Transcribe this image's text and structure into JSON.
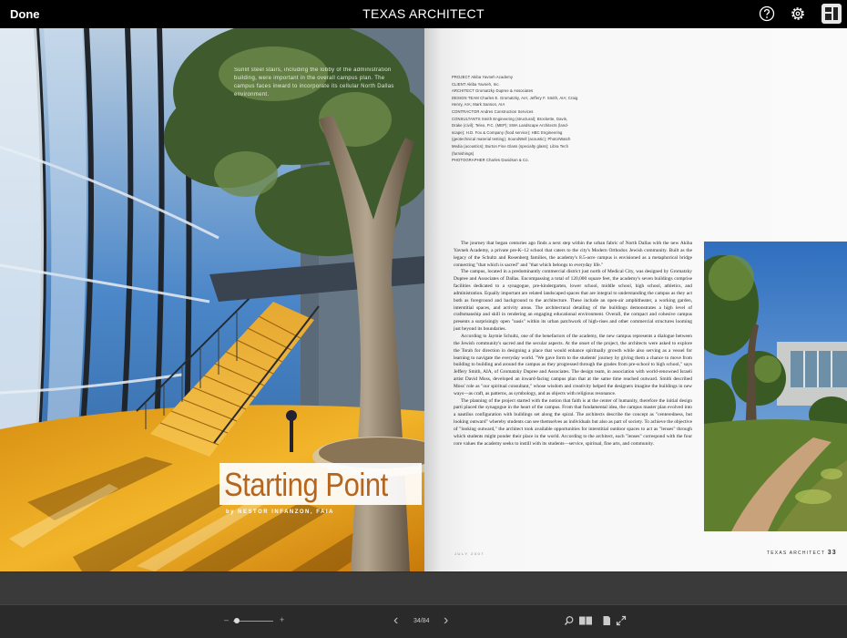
{
  "topbar": {
    "done_label": "Done",
    "title": "TEXAS ARCHITECT",
    "icons": [
      "help-icon",
      "gear-icon",
      "thumbnails-icon"
    ]
  },
  "left_page": {
    "caption": "Sunlit steel stairs, including the lobby of the administration building, were important in the overall campus plan. The campus faces inward to incorporate its cellular North Dallas environment.",
    "feature_title": "Starting Point",
    "byline": "by NESTOR INFANZON, FAIA"
  },
  "right_page": {
    "credits": [
      "PROJECT Akiba Yavneh Academy",
      "CLIENT Akiba Yavneh, Inc.",
      "ARCHITECT Gromatzky Dupree & Associates",
      "DESIGN TEAM Charles E. Gromatzky, AIA; Jeffery F. Smith, AIA; Craig",
      "Henry, AIA; Mark Sanson, AIA",
      "CONTRACTOR Andres Construction Services",
      "CONSULTANTS Smith Engineering (structural); Brockette, Davis,",
      "Drake (civil); Teleo, P.C. (MEP); SWA Landscape Architects (land-",
      "scape); H.D. Fox & Company (food service); HBC Engineering",
      "(geotechnical material testing); SoundWell (acoustic); Photo/Watch",
      "Media (acoustics); Burton Fine Glass (specialty glass); Libra Tech",
      "(furnishings)",
      "PHOTOGRAPHER Charles Davidson & Co."
    ],
    "body_paragraphs": [
      "The journey that began centuries ago finds a next step within the urban fabric of North Dallas with the new Akiba Yavneh Academy, a private pre-K–12 school that caters to the city's Modern Orthodox Jewish community. Built as the legacy of the Schultz and Rosenberg families, the academy's 8.5-acre campus is envisioned as a metaphorical bridge connecting \"that which is sacred\" and \"that which belongs to everyday life.\"",
      "The campus, located in a predominantly commercial district just north of Medical City, was designed by Gromatzky Dupree and Associates of Dallas. Encompassing a total of 120,000 square feet, the academy's seven buildings comprise facilities dedicated to a synagogue, pre-kindergarten, lower school, middle school, high school, athletics, and administration. Equally important are related landscaped spaces that are integral to understanding the campus as they act both as foreground and background to the architecture. These include an open-air amphitheater, a working garden, interstitial spaces, and activity areas. The architectural detailing of the buildings demonstrates a high level of craftsmanship and skill in rendering an engaging educational environment. Overall, the compact and cohesive campus presents a surprisingly open \"oasis\" within its urban patchwork of high-rises and other commercial structures looming just beyond its boundaries.",
      "According to Jaymie Schultz, one of the benefactors of the academy, the new campus represents a dialogue between the Jewish community's sacred and the secular aspects. At the onset of the project, the architects were asked to explore the Torah for direction in designing a place that would enhance spiritually growth while also serving as a vessel for learning to navigate the everyday world. \"We gave form to the students' journey by giving them a chance to move from building to building and around the campus as they progressed through the grades from pre-school to high school,\" says Jeffery Smith, AIA, of Gromatzky Dupree and Associates. The design team, in association with world-renowned Israeli artist David Moss, developed an inward-facing campus plan that at the same time reached outward. Smith described Moss' role as \"our spiritual consultant,\" whose wisdom and creativity helped the designers imagine the buildings in new ways—as craft, as patterns, as symbology, and as objects with religious resonance.",
      "The planning of the project started with the notion that faith is at the center of humanity, therefore the initial design parti placed the synagogue in the heart of the campus. From that fundamental idea, the campus master plan evolved into a nautilus configuration with buildings set along the spiral. The architects describe the concept as \"centeredness, but looking outward\" whereby students can see themselves as individuals but also as part of society. To achieve the objective of \"looking outward,\" the architect took available opportunities for interstitial outdoor spaces to act as \"lenses\" through which students might ponder their place in the world. According to the architect, each \"lenses\" correspond with the four core values the academy seeks to instill with its students—service, spiritual, fine arts, and community."
    ],
    "folio_left": "JULY 2007",
    "folio_right_label": "TEXAS ARCHITECT",
    "folio_right_number": "33"
  },
  "bottombar": {
    "zoom_minus": "–",
    "zoom_plus": "+",
    "zoom_level": 0.1,
    "prev_label": "‹",
    "page_indicator": "34/84",
    "next_label": "›",
    "icons": [
      "search-icon",
      "two-page-view-icon",
      "single-page-icon",
      "fullscreen-icon"
    ]
  }
}
